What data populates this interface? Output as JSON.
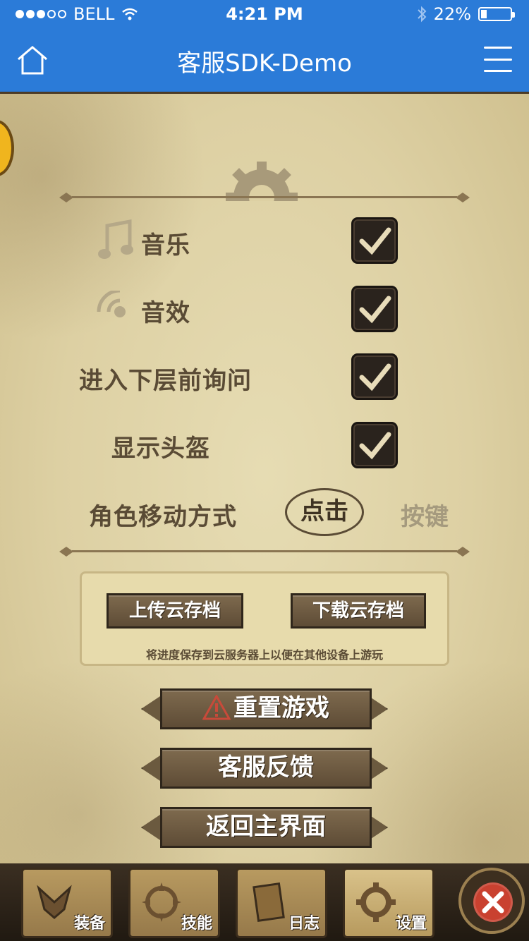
{
  "status_bar": {
    "carrier": "BELL",
    "time": "4:21 PM",
    "battery": "22%",
    "battery_level": 0.22
  },
  "navbar": {
    "title": "客服SDK-Demo",
    "home_icon": "home-icon",
    "menu_icon": "menu-icon"
  },
  "settings": {
    "music_label": "音乐",
    "music_checked": true,
    "sound_label": "音效",
    "sound_checked": true,
    "ask_before_next_floor_label": "进入下层前询问",
    "ask_checked": true,
    "show_helmet_label": "显示头盔",
    "helmet_checked": true,
    "move_mode_label": "角色移动方式",
    "move_mode_options": [
      "点击",
      "按键"
    ],
    "move_mode_selected": "点击"
  },
  "cloud": {
    "upload_label": "上传云存档",
    "download_label": "下载云存档",
    "note": "将进度保存到云服务器上以便在其他设备上游玩"
  },
  "actions": {
    "reset_label": "重置游戏",
    "support_label": "客服反馈",
    "main_menu_label": "返回主界面"
  },
  "toolbar": {
    "tabs": [
      {
        "label": "装备",
        "icon": "equipment-icon"
      },
      {
        "label": "技能",
        "icon": "skill-icon"
      },
      {
        "label": "日志",
        "icon": "log-icon"
      },
      {
        "label": "设置",
        "icon": "settings-gear-icon"
      }
    ],
    "active_tab": "设置",
    "close_icon": "close-icon"
  },
  "colors": {
    "nav_blue": "#2b7bd8",
    "parchment": "#ddd0a3",
    "text_brown": "#5a4b35",
    "checkbox_dark": "#2a231d",
    "close_red": "#c94130"
  }
}
